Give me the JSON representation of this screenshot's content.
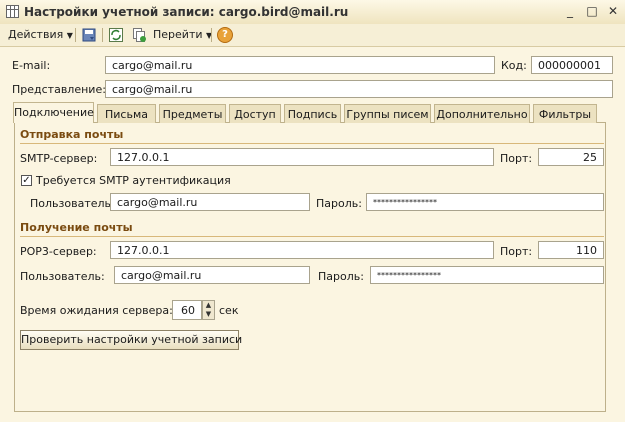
{
  "window": {
    "title": "Настройки учетной записи: cargo.bird@mail.ru",
    "minimize": "_",
    "maximize": "□",
    "close": "✕"
  },
  "toolbar": {
    "actions_label": "Действия",
    "go_label": "Перейти",
    "help_label": "?"
  },
  "header": {
    "email_label": "E-mail:",
    "email_value": "cargo@mail.ru",
    "code_label": "Код:",
    "code_value": "000000001",
    "presentation_label": "Представление:",
    "presentation_value": "cargo@mail.ru"
  },
  "tabs": [
    {
      "label": "Подключение",
      "active": true
    },
    {
      "label": "Письма"
    },
    {
      "label": "Предметы"
    },
    {
      "label": "Доступ"
    },
    {
      "label": "Подпись"
    },
    {
      "label": "Группы писем"
    },
    {
      "label": "Дополнительно"
    },
    {
      "label": "Фильтры"
    }
  ],
  "outgoing": {
    "section_title": "Отправка почты",
    "server_label": "SMTP-сервер:",
    "server_value": "127.0.0.1",
    "port_label": "Порт:",
    "port_value": "25",
    "auth_checked": true,
    "auth_label": "Требуется SMTP аутентификация",
    "user_label": "Пользователь:",
    "user_value": "cargo@mail.ru",
    "password_label": "Пароль:",
    "password_value": "****************"
  },
  "incoming": {
    "section_title": "Получение почты",
    "server_label": "POP3-сервер:",
    "server_value": "127.0.0.1",
    "port_label": "Порт:",
    "port_value": "110",
    "user_label": "Пользователь:",
    "user_value": "cargo@mail.ru",
    "password_label": "Пароль:",
    "password_value": "****************"
  },
  "timeout": {
    "label": "Время ожидания сервера:",
    "value": "60",
    "unit": "сек"
  },
  "check_button_label": "Проверить настройки учетной записи",
  "colors": {
    "background": "#fbf5e1",
    "section_title": "#7a4b10",
    "help_icon": "#e8a23a"
  },
  "icons": {
    "window": "window-grid-icon",
    "toolbar": [
      "save-icon",
      "refresh-icon",
      "copy-icon",
      "help-icon"
    ]
  }
}
